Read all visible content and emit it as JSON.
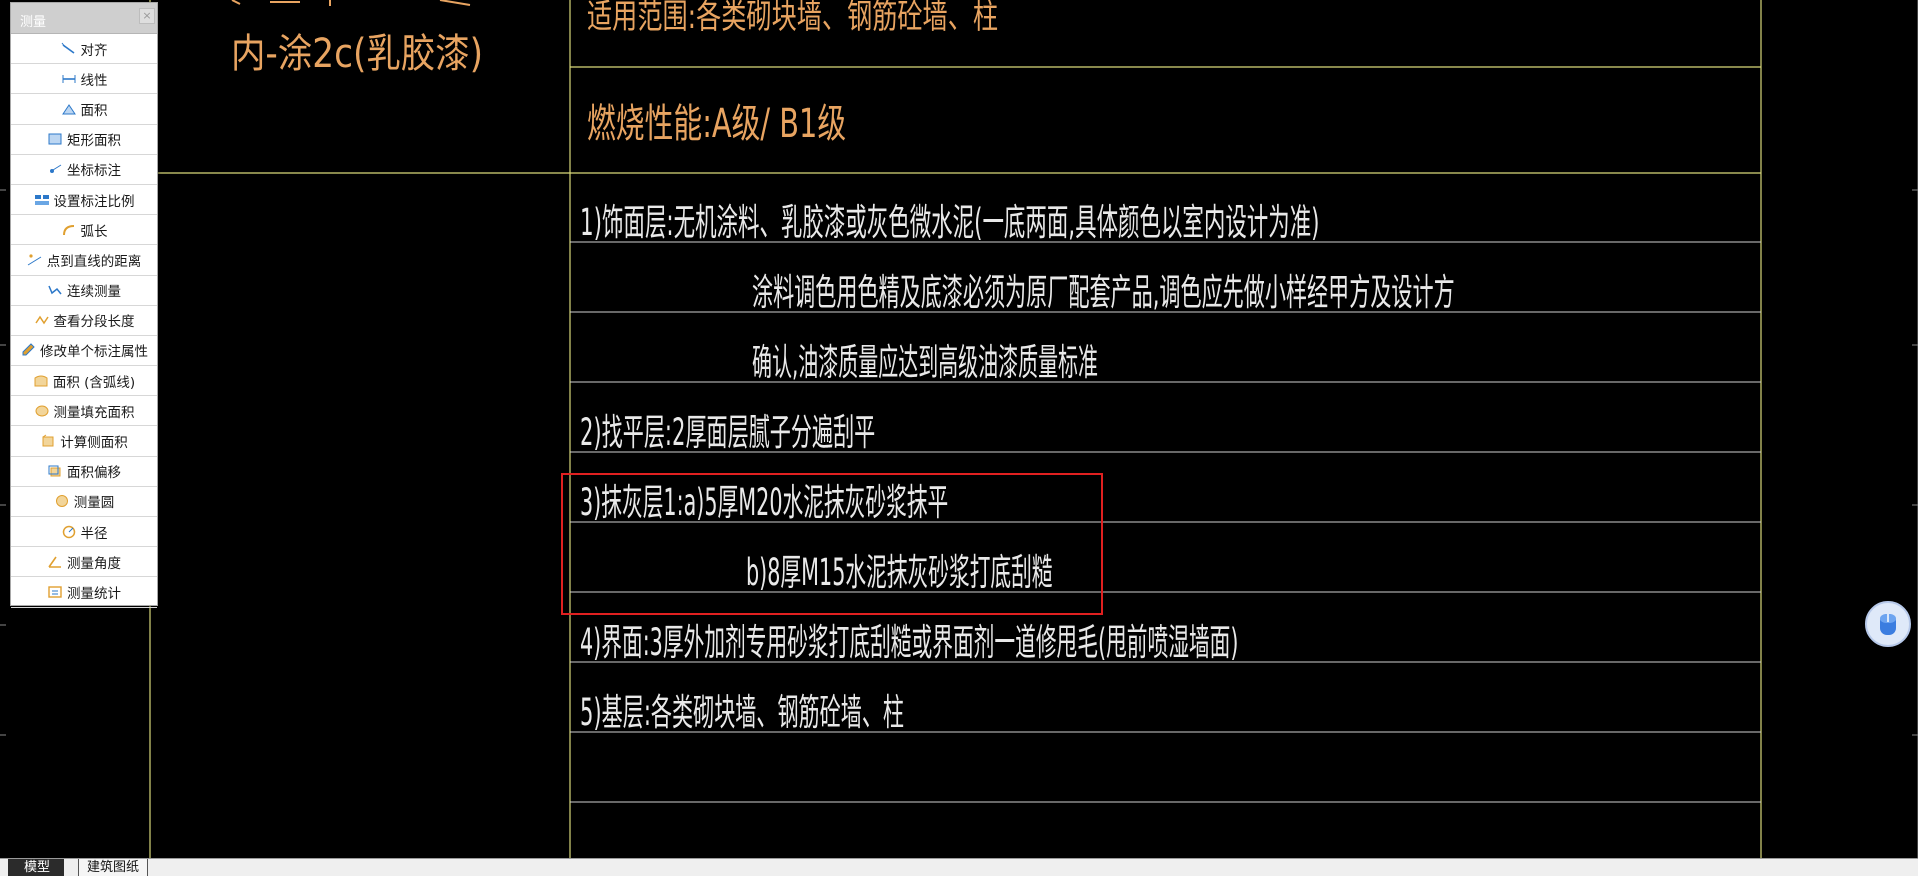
{
  "measure_panel": {
    "title": "测量",
    "close_glyph": "×",
    "items": [
      {
        "label": "对齐",
        "icon": "align-measure-icon"
      },
      {
        "label": "线性",
        "icon": "linear-measure-icon"
      },
      {
        "label": "面积",
        "icon": "area-icon"
      },
      {
        "label": "矩形面积",
        "icon": "rect-area-icon"
      },
      {
        "label": "坐标标注",
        "icon": "coordinate-icon"
      },
      {
        "label": "设置标注比例",
        "icon": "scale-settings-icon"
      },
      {
        "label": "弧长",
        "icon": "arc-length-icon"
      },
      {
        "label": "点到直线的距离",
        "icon": "point-line-distance-icon"
      },
      {
        "label": "连续测量",
        "icon": "continuous-measure-icon"
      },
      {
        "label": "查看分段长度",
        "icon": "segment-length-icon"
      },
      {
        "label": "修改单个标注属性",
        "icon": "edit-annotation-icon"
      },
      {
        "label": "面积 (含弧线)",
        "icon": "arc-area-icon"
      },
      {
        "label": "测量填充面积",
        "icon": "fill-area-icon"
      },
      {
        "label": "计算侧面积",
        "icon": "side-area-icon"
      },
      {
        "label": "面积偏移",
        "icon": "area-offset-icon"
      },
      {
        "label": "测量圆",
        "icon": "circle-measure-icon"
      },
      {
        "label": "半径",
        "icon": "radius-icon"
      },
      {
        "label": "测量角度",
        "icon": "angle-icon"
      },
      {
        "label": "测量统计",
        "icon": "statistics-icon"
      }
    ]
  },
  "drawing": {
    "left_line_partial": "内-涂2c(乳胶漆)",
    "scope_text": "适用范围:各类砌块墙、钢筋砼墙、柱",
    "fire_rating_text": "燃烧性能:A级/ B1级",
    "spec_lines": [
      "1)饰面层:无机涂料、乳胶漆或灰色微水泥(一底两面,具体颜色以室内设计为准)",
      "涂料调色用色精及底漆必须为原厂配套产品,调色应先做小样经甲方及设计方",
      "确认,油漆质量应达到高级油漆质量标准",
      "2)找平层:2厚面层腻子分遍刮平",
      "3)抹灰层1:a)5厚M20水泥抹灰砂浆抹平",
      "b)8厚M15水泥抹灰砂浆打底刮糙",
      "4)界面:3厚外加剂专用砂浆打底刮糙或界面剂一道修甩毛(甩前喷湿墙面)",
      "5)基层:各类砌块墙、钢筋砼墙、柱"
    ],
    "colors": {
      "text_orange": "#e8a461",
      "text_white": "#e9e9e9",
      "frame_yellow": "#d9d97a",
      "row_white": "#cfcfcf",
      "selection_red": "#e02020"
    }
  },
  "tabs": {
    "model": "模型",
    "architecture": "建筑图纸"
  }
}
